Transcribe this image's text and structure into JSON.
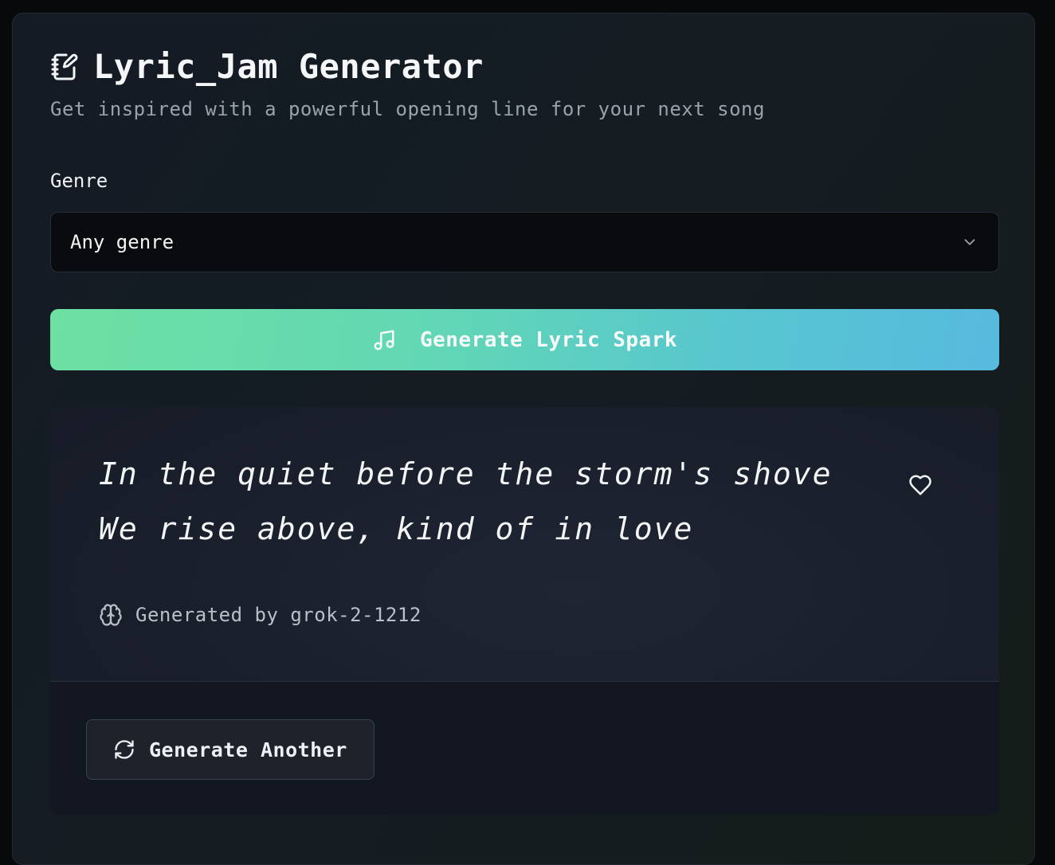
{
  "app": {
    "title": "Lyric_Jam Generator",
    "subtitle": "Get inspired with a powerful opening line for your next song",
    "title_icon": "notebook-pen-icon"
  },
  "genre": {
    "label": "Genre",
    "selected": "Any genre",
    "icon": "chevron-down-icon"
  },
  "generate_button": {
    "label": "Generate Lyric Spark",
    "icon": "music-note-icon"
  },
  "result": {
    "lines": [
      "In the quiet before the storm's shove",
      "We rise above, kind of in love"
    ],
    "favorite_icon": "heart-icon",
    "model_icon": "brain-icon",
    "model_text": "Generated by grok-2-1212"
  },
  "another_button": {
    "label": "Generate Another",
    "icon": "refresh-icon"
  },
  "colors": {
    "accent_start": "#6de0a2",
    "accent_end": "#57badf",
    "background": "#08090b",
    "card": "#151c22"
  }
}
